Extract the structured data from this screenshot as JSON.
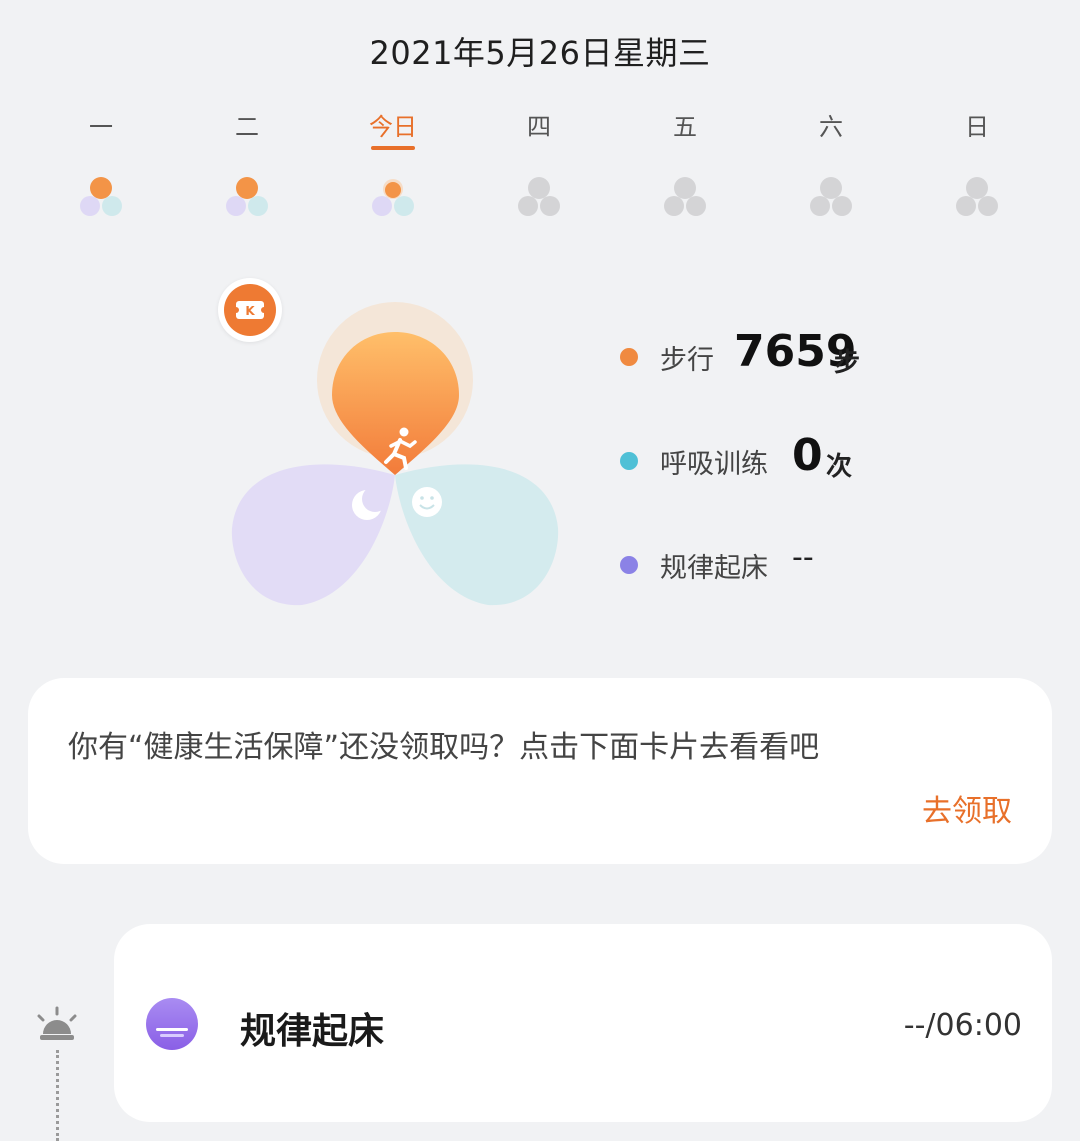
{
  "date_title": "2021年5月26日星期三",
  "week": {
    "days": [
      {
        "label": "一",
        "state": "done"
      },
      {
        "label": "二",
        "state": "done"
      },
      {
        "label": "今日",
        "state": "today"
      },
      {
        "label": "四",
        "state": "future"
      },
      {
        "label": "五",
        "state": "future"
      },
      {
        "label": "六",
        "state": "future"
      },
      {
        "label": "日",
        "state": "future"
      }
    ]
  },
  "colors": {
    "accent": "#e8702a",
    "walk": "#f08a40",
    "breath": "#4fc0d6",
    "wake": "#8b82e6"
  },
  "stats": {
    "walk": {
      "label": "步行",
      "value": "7659",
      "unit": "步"
    },
    "breath": {
      "label": "呼吸训练",
      "value": "0",
      "unit": "次"
    },
    "wake": {
      "label": "规律起床",
      "value": "--"
    }
  },
  "promo": {
    "message": "你有“健康生活保障”还没领取吗？点击下面卡片去看看吧",
    "action": "去领取"
  },
  "task": {
    "title": "规律起床",
    "time": "--/06:00"
  },
  "icons": {
    "ticket": "ticket-icon",
    "run": "running-person-icon",
    "moon": "moon-icon",
    "smile": "smile-icon",
    "alarm": "alarm-bell-icon"
  }
}
